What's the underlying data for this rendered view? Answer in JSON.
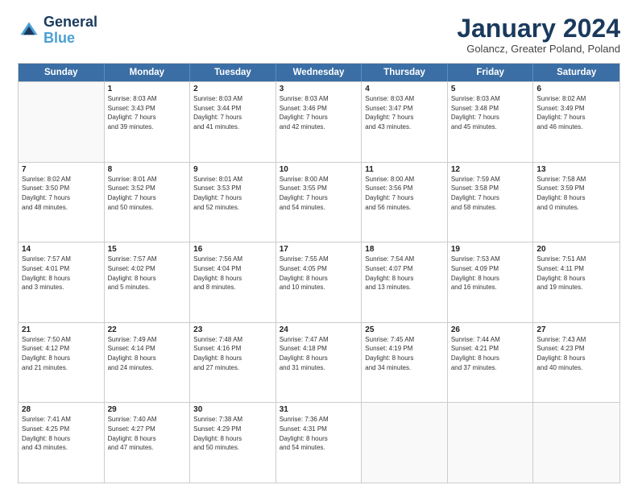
{
  "logo": {
    "line1": "General",
    "line2": "Blue"
  },
  "title": "January 2024",
  "subtitle": "Golancz, Greater Poland, Poland",
  "days": [
    "Sunday",
    "Monday",
    "Tuesday",
    "Wednesday",
    "Thursday",
    "Friday",
    "Saturday"
  ],
  "weeks": [
    [
      {
        "day": "",
        "info": ""
      },
      {
        "day": "1",
        "info": "Sunrise: 8:03 AM\nSunset: 3:43 PM\nDaylight: 7 hours\nand 39 minutes."
      },
      {
        "day": "2",
        "info": "Sunrise: 8:03 AM\nSunset: 3:44 PM\nDaylight: 7 hours\nand 41 minutes."
      },
      {
        "day": "3",
        "info": "Sunrise: 8:03 AM\nSunset: 3:46 PM\nDaylight: 7 hours\nand 42 minutes."
      },
      {
        "day": "4",
        "info": "Sunrise: 8:03 AM\nSunset: 3:47 PM\nDaylight: 7 hours\nand 43 minutes."
      },
      {
        "day": "5",
        "info": "Sunrise: 8:03 AM\nSunset: 3:48 PM\nDaylight: 7 hours\nand 45 minutes."
      },
      {
        "day": "6",
        "info": "Sunrise: 8:02 AM\nSunset: 3:49 PM\nDaylight: 7 hours\nand 46 minutes."
      }
    ],
    [
      {
        "day": "7",
        "info": "Sunrise: 8:02 AM\nSunset: 3:50 PM\nDaylight: 7 hours\nand 48 minutes."
      },
      {
        "day": "8",
        "info": "Sunrise: 8:01 AM\nSunset: 3:52 PM\nDaylight: 7 hours\nand 50 minutes."
      },
      {
        "day": "9",
        "info": "Sunrise: 8:01 AM\nSunset: 3:53 PM\nDaylight: 7 hours\nand 52 minutes."
      },
      {
        "day": "10",
        "info": "Sunrise: 8:00 AM\nSunset: 3:55 PM\nDaylight: 7 hours\nand 54 minutes."
      },
      {
        "day": "11",
        "info": "Sunrise: 8:00 AM\nSunset: 3:56 PM\nDaylight: 7 hours\nand 56 minutes."
      },
      {
        "day": "12",
        "info": "Sunrise: 7:59 AM\nSunset: 3:58 PM\nDaylight: 7 hours\nand 58 minutes."
      },
      {
        "day": "13",
        "info": "Sunrise: 7:58 AM\nSunset: 3:59 PM\nDaylight: 8 hours\nand 0 minutes."
      }
    ],
    [
      {
        "day": "14",
        "info": "Sunrise: 7:57 AM\nSunset: 4:01 PM\nDaylight: 8 hours\nand 3 minutes."
      },
      {
        "day": "15",
        "info": "Sunrise: 7:57 AM\nSunset: 4:02 PM\nDaylight: 8 hours\nand 5 minutes."
      },
      {
        "day": "16",
        "info": "Sunrise: 7:56 AM\nSunset: 4:04 PM\nDaylight: 8 hours\nand 8 minutes."
      },
      {
        "day": "17",
        "info": "Sunrise: 7:55 AM\nSunset: 4:05 PM\nDaylight: 8 hours\nand 10 minutes."
      },
      {
        "day": "18",
        "info": "Sunrise: 7:54 AM\nSunset: 4:07 PM\nDaylight: 8 hours\nand 13 minutes."
      },
      {
        "day": "19",
        "info": "Sunrise: 7:53 AM\nSunset: 4:09 PM\nDaylight: 8 hours\nand 16 minutes."
      },
      {
        "day": "20",
        "info": "Sunrise: 7:51 AM\nSunset: 4:11 PM\nDaylight: 8 hours\nand 19 minutes."
      }
    ],
    [
      {
        "day": "21",
        "info": "Sunrise: 7:50 AM\nSunset: 4:12 PM\nDaylight: 8 hours\nand 21 minutes."
      },
      {
        "day": "22",
        "info": "Sunrise: 7:49 AM\nSunset: 4:14 PM\nDaylight: 8 hours\nand 24 minutes."
      },
      {
        "day": "23",
        "info": "Sunrise: 7:48 AM\nSunset: 4:16 PM\nDaylight: 8 hours\nand 27 minutes."
      },
      {
        "day": "24",
        "info": "Sunrise: 7:47 AM\nSunset: 4:18 PM\nDaylight: 8 hours\nand 31 minutes."
      },
      {
        "day": "25",
        "info": "Sunrise: 7:45 AM\nSunset: 4:19 PM\nDaylight: 8 hours\nand 34 minutes."
      },
      {
        "day": "26",
        "info": "Sunrise: 7:44 AM\nSunset: 4:21 PM\nDaylight: 8 hours\nand 37 minutes."
      },
      {
        "day": "27",
        "info": "Sunrise: 7:43 AM\nSunset: 4:23 PM\nDaylight: 8 hours\nand 40 minutes."
      }
    ],
    [
      {
        "day": "28",
        "info": "Sunrise: 7:41 AM\nSunset: 4:25 PM\nDaylight: 8 hours\nand 43 minutes."
      },
      {
        "day": "29",
        "info": "Sunrise: 7:40 AM\nSunset: 4:27 PM\nDaylight: 8 hours\nand 47 minutes."
      },
      {
        "day": "30",
        "info": "Sunrise: 7:38 AM\nSunset: 4:29 PM\nDaylight: 8 hours\nand 50 minutes."
      },
      {
        "day": "31",
        "info": "Sunrise: 7:36 AM\nSunset: 4:31 PM\nDaylight: 8 hours\nand 54 minutes."
      },
      {
        "day": "",
        "info": ""
      },
      {
        "day": "",
        "info": ""
      },
      {
        "day": "",
        "info": ""
      }
    ]
  ]
}
